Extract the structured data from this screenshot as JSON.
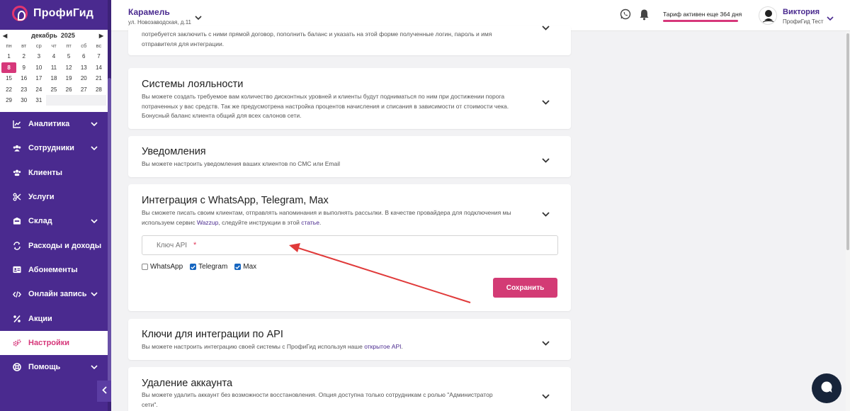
{
  "brand": {
    "name": "ПрофиГид"
  },
  "calendar": {
    "month_label": "декабрь",
    "year_label": "2025",
    "weekdays": [
      "пн",
      "вт",
      "ср",
      "чт",
      "пт",
      "сб",
      "вс"
    ],
    "weeks": [
      [
        "1",
        "2",
        "3",
        "4",
        "5",
        "6",
        "7"
      ],
      [
        "8",
        "9",
        "10",
        "11",
        "12",
        "13",
        "14"
      ],
      [
        "15",
        "16",
        "17",
        "18",
        "19",
        "20",
        "21"
      ],
      [
        "22",
        "23",
        "24",
        "25",
        "26",
        "27",
        "28"
      ],
      [
        "29",
        "30",
        "31",
        "",
        "",
        "",
        ""
      ]
    ],
    "today": "8"
  },
  "nav": {
    "items": [
      {
        "label": "Аналитика",
        "icon": "chart-line-icon"
      },
      {
        "label": "Сотрудники",
        "icon": "users-icon"
      },
      {
        "label": "Клиенты",
        "icon": "clients-icon"
      },
      {
        "label": "Услуги",
        "icon": "scissors-icon"
      },
      {
        "label": "Склад",
        "icon": "warehouse-icon"
      },
      {
        "label": "Расходы и доходы",
        "icon": "exchange-icon"
      },
      {
        "label": "Абонементы",
        "icon": "card-icon"
      },
      {
        "label": "Онлайн запись",
        "icon": "code-icon"
      },
      {
        "label": "Акции",
        "icon": "percent-icon"
      },
      {
        "label": "Настройки",
        "icon": "settings-icon"
      },
      {
        "label": "Помощь",
        "icon": "help-icon"
      }
    ]
  },
  "header": {
    "branch_name": "Карамель",
    "branch_address": "ул. Новозаводская, д.11",
    "tariff_text": "Тариф активен еще 364 дня",
    "user_name": "Виктория",
    "user_org": "ПрофиГид Тест"
  },
  "cards": {
    "top_desc_line1": "потребуется заключить с ними прямой договор, пополнить баланс и указать на этой форме полученные логин, пароль и имя",
    "top_desc_line2": "отправителя для интеграции.",
    "loyalty_title": "Системы лояльности",
    "loyalty_desc": "Вы можете создать требуемое вам количество дисконтных уровней и клиенты будут подниматься по ним при достижении порога потраченных у вас средств. Так же предусмотрена настройка процентов начисления и списания в зависимости от стоимости чека. Бонусный баланс клиента общий для всех салонов сети.",
    "notif_title": "Уведомления",
    "notif_desc": "Вы можете настроить уведомления ваших клиентов по СМС или Email",
    "wa_title": "Интеграция с WhatsApp, Telegram, Max",
    "wa_desc_a": "Вы сможете писать своим клиентам, отправлять напоминания и выполнять рассылки. В качестве провайдера для подключения мы используем сервис ",
    "wa_desc_link1": "Wazzup",
    "wa_desc_b": ", следуйте инструкции в этой ",
    "wa_desc_link2": "статье",
    "wa_desc_c": ".",
    "api_key_placeholder": "Ключ API",
    "api_key_required": "*",
    "chk_whatsapp": "WhatsApp",
    "chk_telegram": "Telegram",
    "chk_max": "Max",
    "save_label": "Сохранить",
    "api_title": "Ключи для интеграции по API",
    "api_desc_a": "Вы можете настроить интеграцию своей системы с ПрофиГид используя наше ",
    "api_desc_link": "открытое API",
    "api_desc_b": ".",
    "delete_title": "Удаление аккаунта",
    "delete_desc": "Вы можете удалить аккаунт без возможности восстановления. Опция доступна только сотрудникам с ролью \"Администратор сети\"."
  },
  "checkbox_state": {
    "whatsapp": false,
    "telegram": true,
    "max": true
  },
  "colors": {
    "sidebar": "#4a2a8f",
    "accent": "#d6377a",
    "annotation_arrow": "#e03a3a"
  }
}
